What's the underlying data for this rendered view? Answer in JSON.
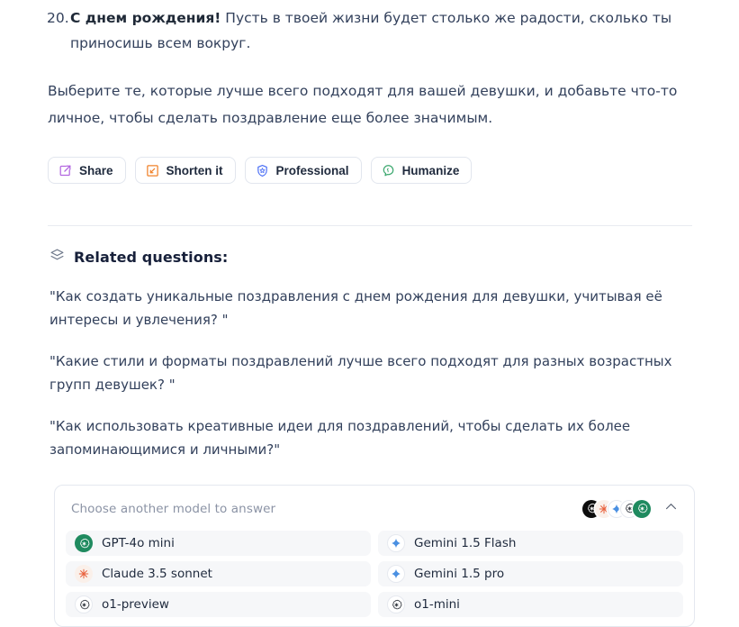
{
  "answer": {
    "number": "20.",
    "bold_lead": "С днем рождения!",
    "rest": " Пусть в твоей жизни будет столько же радости, сколько ты приносишь всем вокруг."
  },
  "closing_paragraph": "Выберите те, которые лучше всего подходят для вашей девушки, и добавьте что-то личное, чтобы сделать поздравление еще более значимым.",
  "actions": [
    {
      "label": "Share",
      "icon": "share-icon",
      "color": "#b266e0"
    },
    {
      "label": "Shorten it",
      "icon": "shorten-icon",
      "color": "#f0822a"
    },
    {
      "label": "Professional",
      "icon": "shield-star-icon",
      "color": "#4a6ef5"
    },
    {
      "label": "Humanize",
      "icon": "humanize-brain-icon",
      "color": "#3aa76d"
    }
  ],
  "related": {
    "icon": "layers-icon",
    "title": "Related questions:",
    "questions": [
      "\"Как создать уникальные поздравления с днем рождения для девушки, учитывая её интересы и увлечения? \"",
      "\"Какие стили и форматы поздравлений лучше всего подходят для разных возрастных групп девушек? \"",
      "\"Как использовать креативные идеи для поздравлений, чтобы сделать их более запоминающимися и личными?\""
    ]
  },
  "model_picker": {
    "title": "Choose another model to answer",
    "collapse_icon": "chevron-up-icon",
    "avatars": [
      {
        "name": "openai-black-avatar",
        "style": "black"
      },
      {
        "name": "claude-avatar",
        "style": "claude"
      },
      {
        "name": "gemini-avatar",
        "style": "gemini"
      },
      {
        "name": "openai-white-avatar",
        "style": "white"
      },
      {
        "name": "openai-green-avatar",
        "style": "green"
      }
    ],
    "models": [
      {
        "label": "GPT-4o mini",
        "icon": "openai-icon",
        "style": "green"
      },
      {
        "label": "Gemini 1.5 Flash",
        "icon": "gemini-icon",
        "style": "gemini"
      },
      {
        "label": "Claude 3.5 sonnet",
        "icon": "claude-icon",
        "style": "claude"
      },
      {
        "label": "Gemini 1.5 pro",
        "icon": "gemini-icon",
        "style": "gemini"
      },
      {
        "label": "o1-preview",
        "icon": "openai-icon",
        "style": "white"
      },
      {
        "label": "o1-mini",
        "icon": "openai-icon",
        "style": "white"
      }
    ]
  }
}
